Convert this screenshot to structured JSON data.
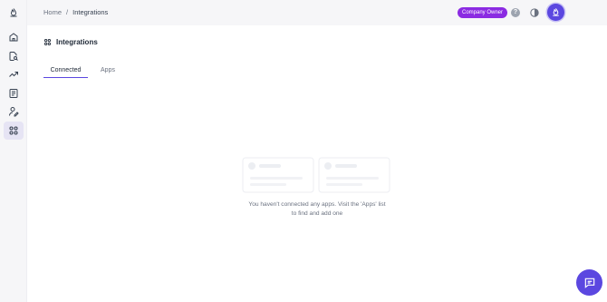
{
  "header": {
    "breadcrumb": {
      "home": "Home",
      "separator": "/",
      "current": "Integrations"
    },
    "role_badge": "Company Owner",
    "help_icon": "help-circle-icon",
    "theme_icon": "theme-toggle-icon",
    "avatar_icon": "logo-avatar-icon"
  },
  "sidebar": {
    "items": [
      {
        "name": "logo",
        "icon": "flame-logo-icon"
      },
      {
        "name": "home",
        "icon": "home-icon"
      },
      {
        "name": "search-docs",
        "icon": "search-document-icon"
      },
      {
        "name": "trends",
        "icon": "trend-up-icon"
      },
      {
        "name": "reports",
        "icon": "document-list-icon"
      },
      {
        "name": "user-edit",
        "icon": "user-edit-icon"
      },
      {
        "name": "integrations",
        "icon": "grid-icon",
        "active": true
      }
    ]
  },
  "main": {
    "title": "Integrations",
    "tabs": [
      {
        "label": "Connected",
        "active": true
      },
      {
        "label": "Apps",
        "active": false
      }
    ],
    "empty_state": {
      "line1": "You haven't connected any apps. Visit the 'Apps' list",
      "line2": "to find and add one"
    }
  },
  "chat_fab": {
    "icon": "chat-icon"
  },
  "colors": {
    "accent": "#5b47e0",
    "badge": "#8b2be2",
    "sidebar_bg": "#f6f6f8",
    "active_item_bg": "#e6e4f4"
  }
}
